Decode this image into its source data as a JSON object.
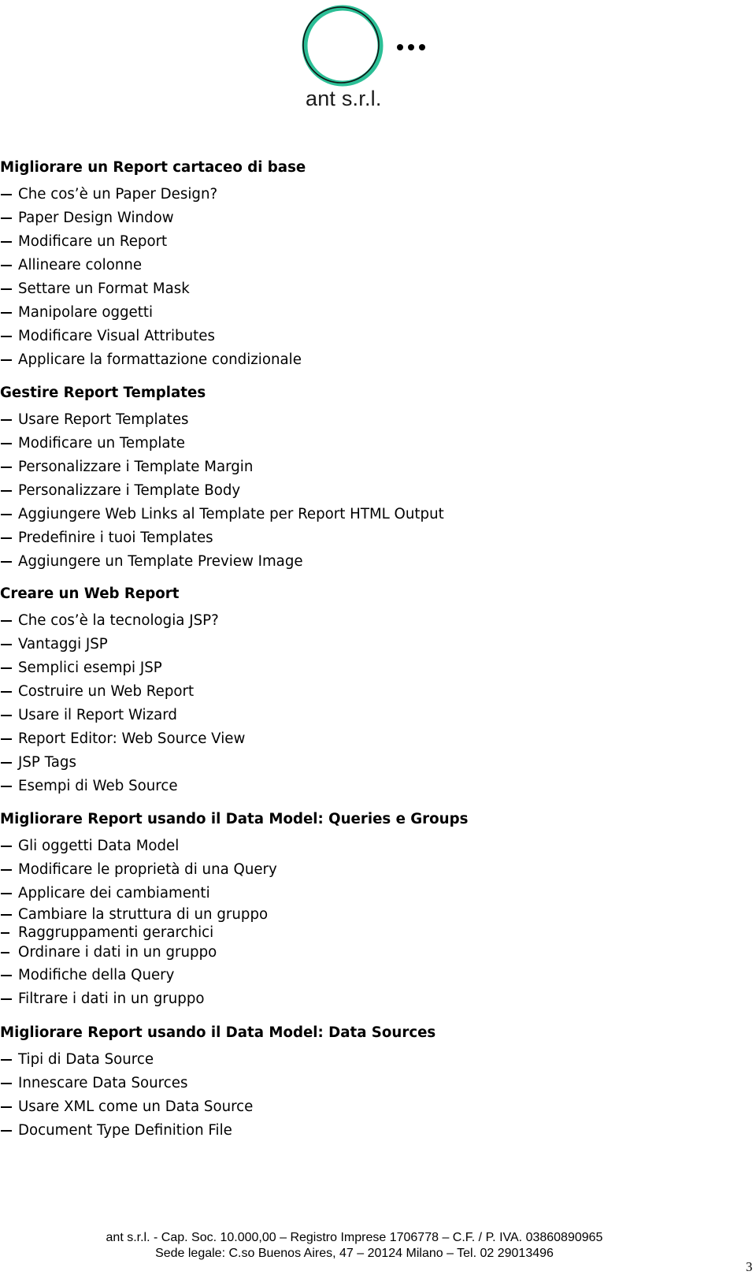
{
  "header": {
    "logo_text": "ant s.r.l.",
    "logo_ring_color": "#2bbf96",
    "logo_outline_color": "#111111"
  },
  "sections": [
    {
      "title": "Migliorare un Report cartaceo di base",
      "items": [
        "Che cos’è un Paper Design?",
        "Paper Design Window",
        "Modificare un Report",
        "Allineare colonne",
        "Settare un Format Mask",
        "Manipolare oggetti",
        "Modificare Visual Attributes",
        "Applicare la formattazione condizionale"
      ]
    },
    {
      "title": "Gestire Report Templates",
      "items": [
        "Usare Report Templates",
        "Modificare un Template",
        "Personalizzare i Template Margin",
        "Personalizzare i Template Body",
        "Aggiungere Web Links al Template per Report HTML Output",
        "Predefinire i tuoi Templates",
        "Aggiungere un Template Preview Image"
      ]
    },
    {
      "title": "Creare un Web Report",
      "items": [
        "Che cos’è la tecnologia JSP?",
        "Vantaggi JSP",
        "Semplici esempi JSP",
        "Costruire un Web Report",
        "Usare il Report Wizard",
        "Report Editor: Web Source View",
        "JSP Tags",
        "Esempi di Web Source"
      ]
    },
    {
      "title": "Migliorare Report usando il Data Model: Queries  e Groups",
      "items": [
        "Gli oggetti Data Model",
        "Modificare le proprietà di una Query",
        "Applicare dei cambiamenti",
        "Cambiare la struttura di un gruppo",
        "Raggruppamenti gerarchici",
        "Ordinare i dati in un gruppo",
        "Modifiche della Query",
        "Filtrare i dati in un gruppo"
      ]
    },
    {
      "title": "Migliorare Report usando il Data Model: Data Sources",
      "items": [
        "Tipi di Data Source",
        "Innescare Data Sources",
        "Usare XML come un Data Source",
        "Document Type Definition File"
      ]
    }
  ],
  "footer": {
    "line1": "ant s.r.l. - Cap. Soc. 10.000,00 – Registro Imprese 1706778 – C.F. / P. IVA. 03860890965",
    "line2": "Sede legale: C.so Buenos Aires, 47 – 20124 Milano – Tel. 02 29013496"
  },
  "page_number": "3"
}
